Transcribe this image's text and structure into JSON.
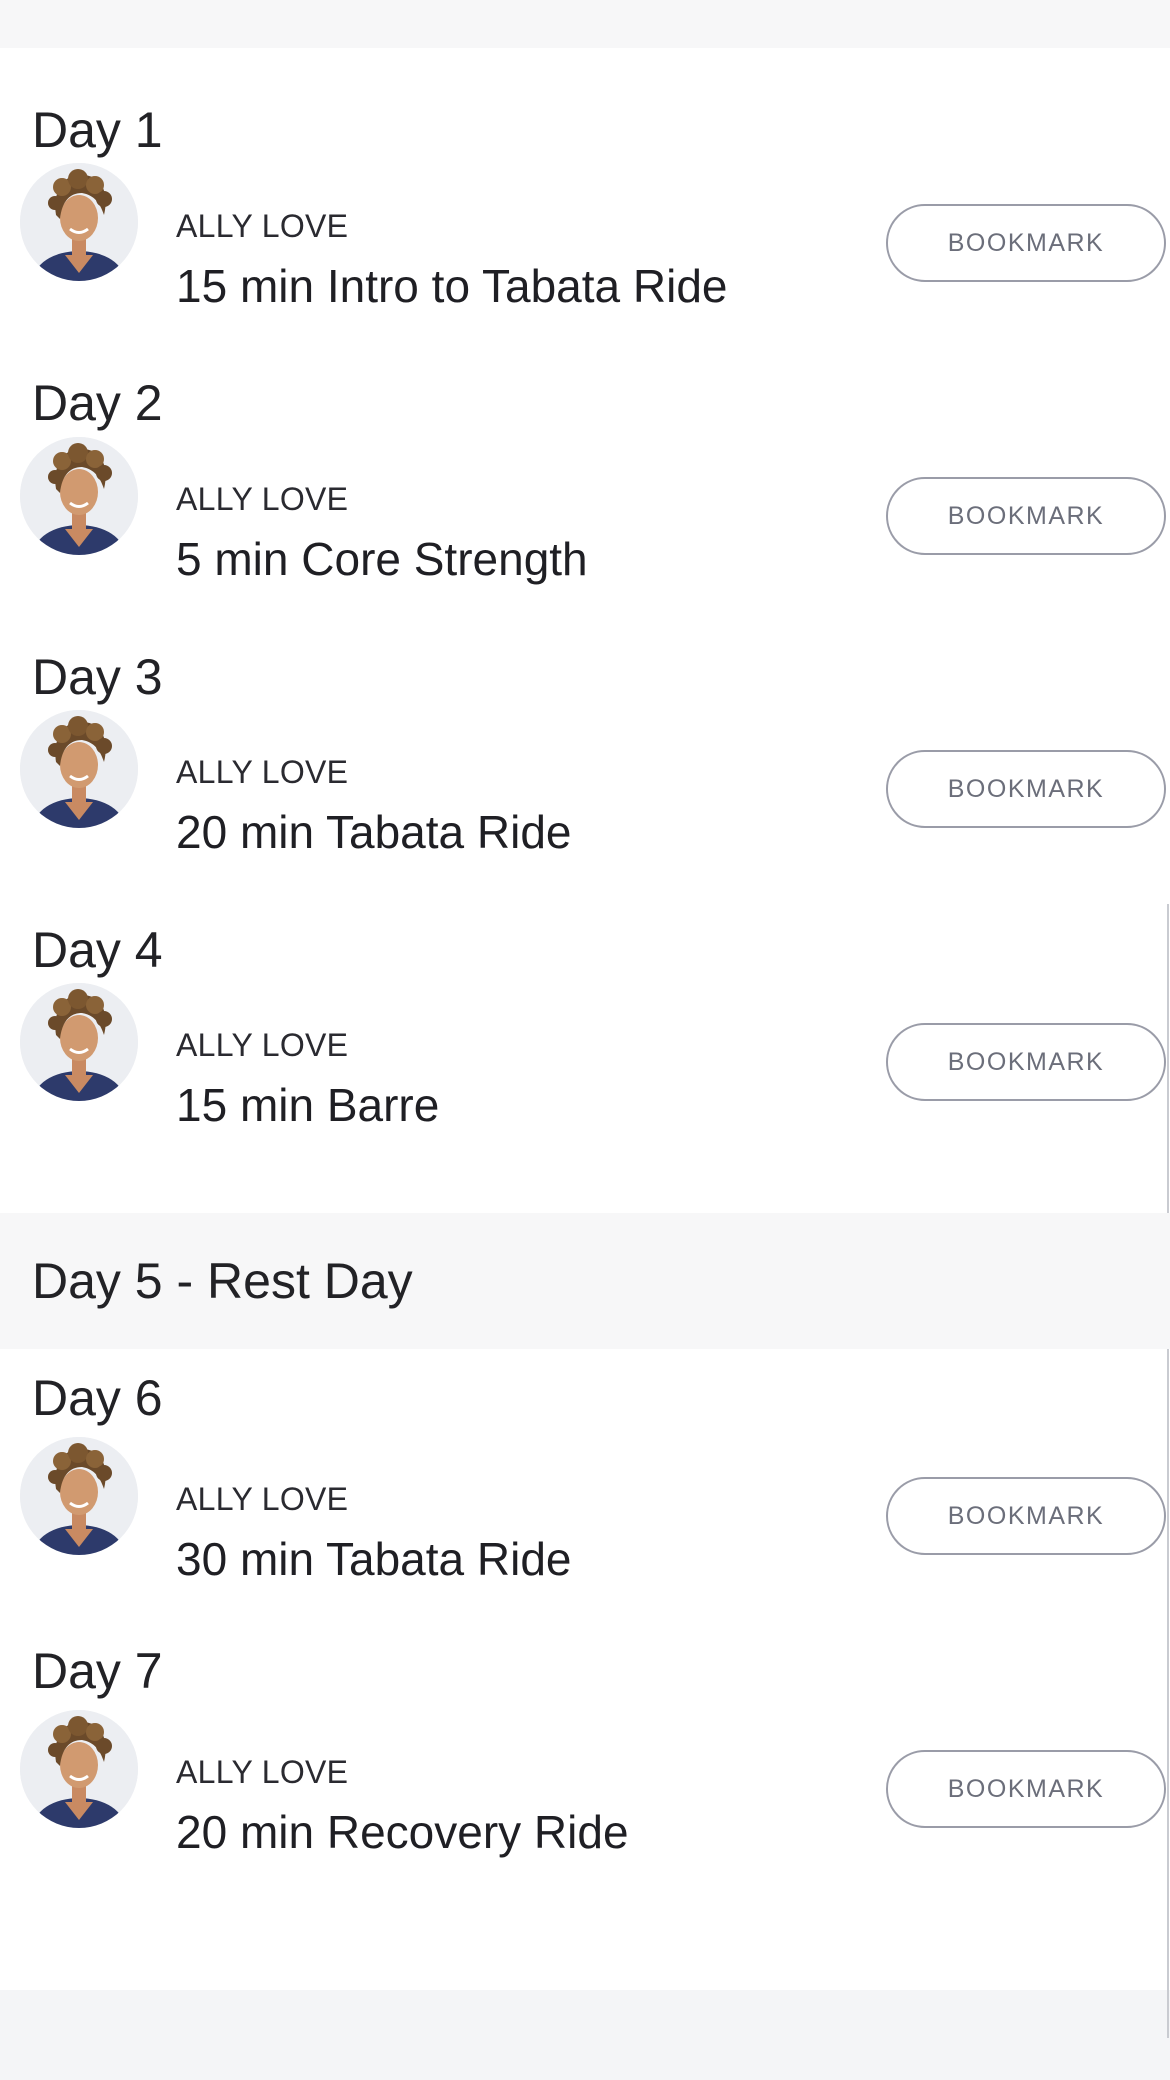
{
  "program": {
    "days": [
      {
        "heading": "Day 1",
        "instructor": "ALLY LOVE",
        "class_title": "15 min Intro to Tabata Ride",
        "bookmark_label": "BOOKMARK"
      },
      {
        "heading": "Day 2",
        "instructor": "ALLY LOVE",
        "class_title": "5 min Core Strength",
        "bookmark_label": "BOOKMARK"
      },
      {
        "heading": "Day 3",
        "instructor": "ALLY LOVE",
        "class_title": "20 min Tabata Ride",
        "bookmark_label": "BOOKMARK"
      },
      {
        "heading": "Day 4",
        "instructor": "ALLY LOVE",
        "class_title": "15 min Barre",
        "bookmark_label": "BOOKMARK"
      },
      {
        "heading": "Day 5 - Rest Day"
      },
      {
        "heading": "Day 6",
        "instructor": "ALLY LOVE",
        "class_title": "30 min Tabata Ride",
        "bookmark_label": "BOOKMARK"
      },
      {
        "heading": "Day 7",
        "instructor": "ALLY LOVE",
        "class_title": "20 min Recovery Ride",
        "bookmark_label": "BOOKMARK"
      }
    ]
  },
  "colors": {
    "page_background": "#ffffff",
    "rest_day_background": "#f7f7f8",
    "bookmark_border": "#9a9ca8",
    "bookmark_text": "#6b6e7a",
    "heading_text": "#222226"
  },
  "icons": {
    "avatar": "instructor-avatar-photo"
  }
}
